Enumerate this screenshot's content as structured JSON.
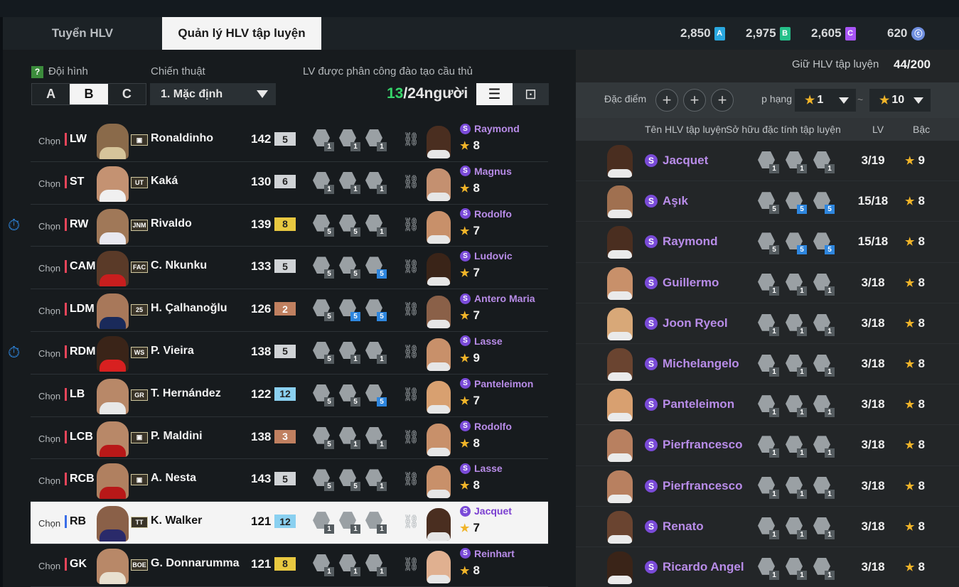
{
  "tabs": {
    "tab1": "Tuyển HLV",
    "tab2": "Quản lý HLV tập luyện"
  },
  "currencies": [
    {
      "value": "2,850",
      "icon": "A",
      "color": "#2aa8e0"
    },
    {
      "value": "2,975",
      "icon": "B",
      "color": "#26c08a"
    },
    {
      "value": "2,605",
      "icon": "C",
      "color": "#a855f7"
    },
    {
      "value": "620",
      "icon": "coin",
      "color": "#6f8fe0"
    }
  ],
  "left": {
    "lineup_label": "Đội hình",
    "tactic_label": "Chiến thuật",
    "assigned_label": "LV được phân công đào tạo cầu thủ",
    "teams": [
      "A",
      "B",
      "C"
    ],
    "selected_team": "B",
    "tactic_value": "1. Mặc định",
    "count_current": "13",
    "count_rest": "/24người",
    "players": [
      {
        "chon": "Chọn",
        "pos": "LW",
        "name": "Ronaldinho",
        "ovr": "142",
        "lvl": "5",
        "lvlcolor": "#d0d3d6",
        "badge": "",
        "coach": "Raymond",
        "stars": "8",
        "traits": [
          [
            "1",
            ""
          ],
          [
            "1",
            ""
          ],
          [
            "1",
            ""
          ]
        ],
        "timer": false,
        "sel": false,
        "skin": "#8a6a4a",
        "jersey": "#d6c49a",
        "coachskin": "#4a2e20"
      },
      {
        "chon": "Chọn",
        "pos": "ST",
        "name": "Kaká",
        "ovr": "130",
        "lvl": "6",
        "lvlcolor": "#d0d3d6",
        "badge": "UT",
        "coach": "Magnus",
        "stars": "8",
        "traits": [
          [
            "1",
            ""
          ],
          [
            "1",
            ""
          ],
          [
            "1",
            ""
          ]
        ],
        "timer": false,
        "sel": false,
        "skin": "#c49272",
        "jersey": "#f0f0f0",
        "coachskin": "#c49070"
      },
      {
        "chon": "Chọn",
        "pos": "RW",
        "name": "Rivaldo",
        "ovr": "139",
        "lvl": "8",
        "lvlcolor": "#e8c840",
        "badge": "JNM",
        "coach": "Rodolfo",
        "stars": "7",
        "traits": [
          [
            "5",
            ""
          ],
          [
            "5",
            ""
          ],
          [
            "1",
            ""
          ]
        ],
        "timer": true,
        "sel": false,
        "skin": "#a07858",
        "jersey": "#e8e8f0",
        "coachskin": "#c8906a"
      },
      {
        "chon": "Chọn",
        "pos": "CAM",
        "name": "C. Nkunku",
        "ovr": "133",
        "lvl": "5",
        "lvlcolor": "#d0d3d6",
        "badge": "FAC",
        "coach": "Ludovic",
        "stars": "7",
        "traits": [
          [
            "5",
            ""
          ],
          [
            "5",
            ""
          ],
          [
            "5",
            "b"
          ]
        ],
        "timer": false,
        "sel": false,
        "skin": "#5a3a28",
        "jersey": "#c81e1e",
        "coachskin": "#3a2418"
      },
      {
        "chon": "Chọn",
        "pos": "LDM",
        "name": "H. Çalhanoğlu",
        "ovr": "126",
        "lvl": "2",
        "lvlcolor": "#c08060",
        "badge": "25",
        "coach": "Antero Maria",
        "stars": "7",
        "traits": [
          [
            "5",
            ""
          ],
          [
            "5",
            "b"
          ],
          [
            "5",
            "b"
          ]
        ],
        "timer": false,
        "sel": false,
        "skin": "#a8785a",
        "jersey": "#1a2a5a",
        "coachskin": "#8a6048"
      },
      {
        "chon": "Chọn",
        "pos": "RDM",
        "name": "P. Vieira",
        "ovr": "138",
        "lvl": "5",
        "lvlcolor": "#d0d3d6",
        "badge": "WS",
        "coach": "Lasse",
        "stars": "9",
        "traits": [
          [
            "5",
            ""
          ],
          [
            "1",
            ""
          ],
          [
            "1",
            ""
          ]
        ],
        "timer": true,
        "sel": false,
        "skin": "#3a2418",
        "jersey": "#d82020",
        "coachskin": "#c8906a"
      },
      {
        "chon": "Chọn",
        "pos": "LB",
        "name": "T. Hernández",
        "ovr": "122",
        "lvl": "12",
        "lvlcolor": "#8ad0f0",
        "badge": "GR",
        "coach": "Panteleimon",
        "stars": "7",
        "traits": [
          [
            "5",
            ""
          ],
          [
            "5",
            ""
          ],
          [
            "5",
            "b"
          ]
        ],
        "timer": false,
        "sel": false,
        "skin": "#b88868",
        "jersey": "#e8e8e8",
        "coachskin": "#d8a070"
      },
      {
        "chon": "Chọn",
        "pos": "LCB",
        "name": "P. Maldini",
        "ovr": "138",
        "lvl": "3",
        "lvlcolor": "#c08060",
        "badge": "",
        "coach": "Rodolfo",
        "stars": "8",
        "traits": [
          [
            "5",
            ""
          ],
          [
            "1",
            ""
          ],
          [
            "1",
            ""
          ]
        ],
        "timer": false,
        "sel": false,
        "skin": "#b88868",
        "jersey": "#b81818",
        "coachskin": "#c8906a"
      },
      {
        "chon": "Chọn",
        "pos": "RCB",
        "name": "A. Nesta",
        "ovr": "143",
        "lvl": "5",
        "lvlcolor": "#d0d3d6",
        "badge": "",
        "coach": "Lasse",
        "stars": "8",
        "traits": [
          [
            "5",
            ""
          ],
          [
            "5",
            ""
          ],
          [
            "1",
            ""
          ]
        ],
        "timer": false,
        "sel": false,
        "skin": "#b08060",
        "jersey": "#b81818",
        "coachskin": "#c8906a"
      },
      {
        "chon": "Chọn",
        "pos": "RB",
        "name": "K. Walker",
        "ovr": "121",
        "lvl": "12",
        "lvlcolor": "#8ad0f0",
        "badge": "TT",
        "coach": "Jacquet",
        "stars": "7",
        "traits": [
          [
            "1",
            ""
          ],
          [
            "1",
            ""
          ],
          [
            "1",
            ""
          ]
        ],
        "timer": false,
        "sel": true,
        "skin": "#8a6048",
        "jersey": "#2a2a6a",
        "coachskin": "#4a2e20"
      },
      {
        "chon": "Chọn",
        "pos": "GK",
        "name": "G. Donnarumma",
        "ovr": "121",
        "lvl": "8",
        "lvlcolor": "#e8c840",
        "badge": "BOE",
        "coach": "Reinhart",
        "stars": "8",
        "traits": [
          [
            "1",
            ""
          ],
          [
            "1",
            ""
          ],
          [
            "1",
            ""
          ]
        ],
        "timer": false,
        "sel": false,
        "skin": "#b88868",
        "jersey": "#e8e0d0",
        "coachskin": "#e0b090"
      }
    ]
  },
  "right": {
    "keep_label": "Giữ HLV tập luyện",
    "keep_value": "44/200",
    "trait_label": "Đặc điểm c",
    "rank_label": "Xếp hạng",
    "star_min": "1",
    "star_max": "10",
    "tilde": "~",
    "col_name": "Tên HLV tập luyện",
    "col_trait": "Sở hữu đặc tính tập luyện",
    "col_lv": "LV",
    "col_grade": "Bậc",
    "coaches": [
      {
        "name": "Jacquet",
        "lv": "3/19",
        "stars": "9",
        "traits": [
          [
            "1",
            ""
          ],
          [
            "1",
            ""
          ],
          [
            "1",
            ""
          ]
        ],
        "skin": "#4a2e20"
      },
      {
        "name": "Aşık",
        "lv": "15/18",
        "stars": "8",
        "traits": [
          [
            "5",
            ""
          ],
          [
            "5",
            "b"
          ],
          [
            "5",
            "b"
          ]
        ],
        "skin": "#a07050"
      },
      {
        "name": "Raymond",
        "lv": "15/18",
        "stars": "8",
        "traits": [
          [
            "5",
            ""
          ],
          [
            "5",
            "b"
          ],
          [
            "5",
            "b"
          ]
        ],
        "skin": "#4a2e20"
      },
      {
        "name": "Guillermo",
        "lv": "3/18",
        "stars": "8",
        "traits": [
          [
            "1",
            ""
          ],
          [
            "1",
            ""
          ],
          [
            "1",
            ""
          ]
        ],
        "skin": "#c8906a"
      },
      {
        "name": "Joon Ryeol",
        "lv": "3/18",
        "stars": "8",
        "traits": [
          [
            "1",
            ""
          ],
          [
            "1",
            ""
          ],
          [
            "1",
            ""
          ]
        ],
        "skin": "#d8a878"
      },
      {
        "name": "Michelangelo",
        "lv": "3/18",
        "stars": "8",
        "traits": [
          [
            "1",
            ""
          ],
          [
            "1",
            ""
          ],
          [
            "1",
            ""
          ]
        ],
        "skin": "#6a4430"
      },
      {
        "name": "Panteleimon",
        "lv": "3/18",
        "stars": "8",
        "traits": [
          [
            "1",
            ""
          ],
          [
            "1",
            ""
          ],
          [
            "1",
            ""
          ]
        ],
        "skin": "#d8a070"
      },
      {
        "name": "Pierfrancesco",
        "lv": "3/18",
        "stars": "8",
        "traits": [
          [
            "1",
            ""
          ],
          [
            "1",
            ""
          ],
          [
            "1",
            ""
          ]
        ],
        "skin": "#b88060"
      },
      {
        "name": "Pierfrancesco",
        "lv": "3/18",
        "stars": "8",
        "traits": [
          [
            "1",
            ""
          ],
          [
            "1",
            ""
          ],
          [
            "1",
            ""
          ]
        ],
        "skin": "#b88060"
      },
      {
        "name": "Renato",
        "lv": "3/18",
        "stars": "8",
        "traits": [
          [
            "1",
            ""
          ],
          [
            "1",
            ""
          ],
          [
            "1",
            ""
          ]
        ],
        "skin": "#6a4430"
      },
      {
        "name": "Ricardo Angel",
        "lv": "3/18",
        "stars": "8",
        "traits": [
          [
            "1",
            ""
          ],
          [
            "1",
            ""
          ],
          [
            "1",
            ""
          ]
        ],
        "skin": "#3a2418"
      }
    ]
  }
}
